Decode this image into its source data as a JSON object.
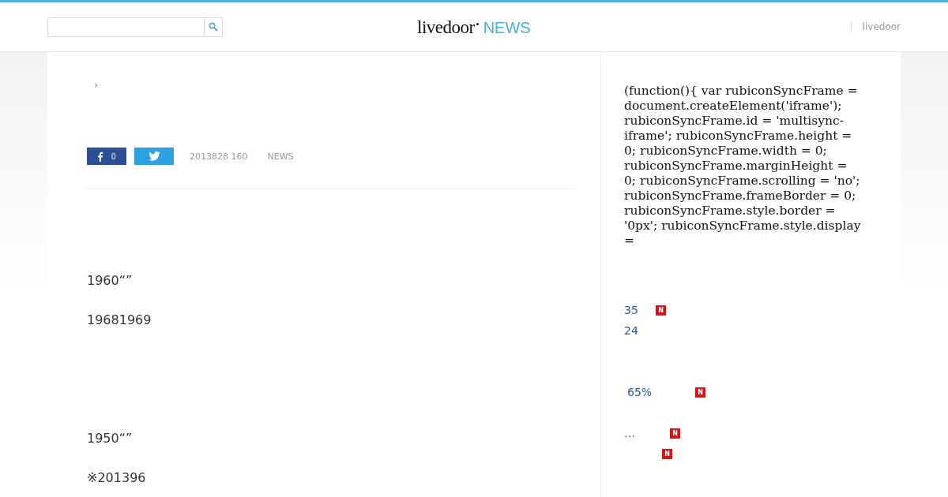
{
  "header": {
    "logo": {
      "brand": "livedoor",
      "product": "NEWS"
    },
    "nav": [
      "livedoor"
    ]
  },
  "article": {
    "breadcrumb_separator": "›",
    "share": {
      "facebook_count": "0"
    },
    "date": "2013828 160",
    "source": "NEWS",
    "paragraphs": [
      "1960“”",
      "19681969",
      "1950“”",
      "※201396"
    ]
  },
  "sidebar": {
    "code": "(function(){ var rubiconSyncFrame = document.createElement('iframe'); rubiconSyncFrame.id = 'multisync-iframe'; rubiconSyncFrame.height = 0; rubiconSyncFrame.width = 0; rubiconSyncFrame.marginHeight = 0; rubiconSyncFrame.scrolling = 'no'; rubiconSyncFrame.frameBorder = 0; rubiconSyncFrame.style.border = '0px'; rubiconSyncFrame.style.display =",
    "items": [
      {
        "text": "35",
        "new": true,
        "badge": "N"
      },
      {
        "text": "24",
        "new": false
      },
      {
        "text": "65%",
        "new": true,
        "badge": "N"
      },
      {
        "text": "…",
        "new": true,
        "badge": "N"
      },
      {
        "new": true,
        "badge": "N"
      }
    ]
  }
}
